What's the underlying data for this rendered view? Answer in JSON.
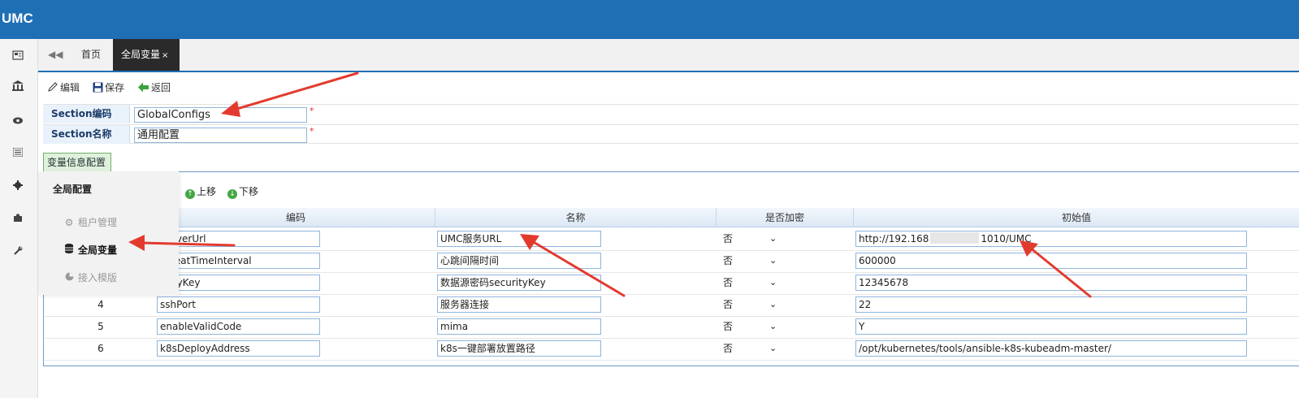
{
  "app": {
    "title": "UMC"
  },
  "sidebar_icons": [
    "dashboard-icon",
    "bank-icon",
    "eye-icon",
    "list-icon",
    "gear-icon",
    "puzzle-icon",
    "wrench-icon"
  ],
  "tabs": {
    "back_glyph": "◀◀",
    "home": "首页",
    "active": "全局变量",
    "close_glyph": "×"
  },
  "toolbar": {
    "edit": "编辑",
    "save": "保存",
    "back": "返回"
  },
  "form": {
    "section_code_label": "Section编码",
    "section_code_value": "GlobalConfigs",
    "section_name_label": "Section名称",
    "section_name_value": "通用配置",
    "required_mark": "*"
  },
  "subtab": "变量信息配置",
  "movebar": {
    "up": "上移",
    "down": "下移"
  },
  "table": {
    "headers": {
      "code": "编码",
      "name": "名称",
      "encrypt": "是否加密",
      "initial": "初始值"
    },
    "rows": [
      {
        "num": "",
        "code": "ServerUrl",
        "name": "UMC服务URL",
        "encrypt": "否",
        "initial_a": "http://192.168",
        "initial_b": "1010/UMC"
      },
      {
        "num": "",
        "code": "rtBeatTimeInterval",
        "name": "心跳间隔时间",
        "encrypt": "否",
        "initial_a": "600000",
        "initial_b": ""
      },
      {
        "num": "",
        "code": "urityKey",
        "name": "数据源密码securityKey",
        "encrypt": "否",
        "initial_a": "12345678",
        "initial_b": ""
      },
      {
        "num": "4",
        "code": "sshPort",
        "name": "服务器连接",
        "encrypt": "否",
        "initial_a": "22",
        "initial_b": ""
      },
      {
        "num": "5",
        "code": "enableValidCode",
        "name": "mima",
        "encrypt": "否",
        "initial_a": "Y",
        "initial_b": ""
      },
      {
        "num": "6",
        "code": "k8sDeployAddress",
        "name": "k8s一键部署放置路径",
        "encrypt": "否",
        "initial_a": "/opt/kubernetes/tools/ansible-k8s-kubeadm-master/",
        "initial_b": ""
      }
    ]
  },
  "flyout": {
    "title": "全局配置",
    "items": [
      {
        "label": "租户管理",
        "icon": "gear-icon",
        "state": "dim"
      },
      {
        "label": "全局变量",
        "icon": "database-icon",
        "state": "active"
      },
      {
        "label": "接入模版",
        "icon": "pie-icon",
        "state": "dim"
      }
    ]
  },
  "colors": {
    "header_blue": "#1f6fb5",
    "arrow_red": "#e23b2e"
  }
}
